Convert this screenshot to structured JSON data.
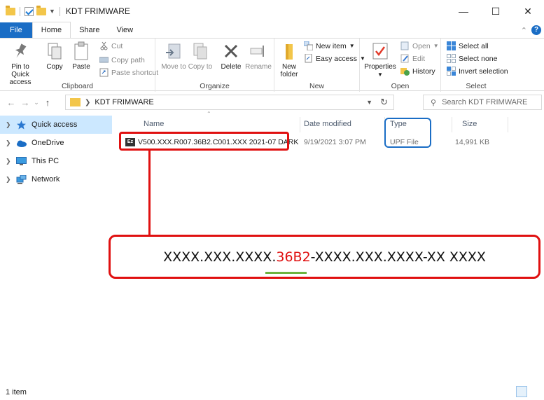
{
  "window": {
    "title": "KDT FRIMWARE",
    "minimize": "—",
    "maximize": "☐",
    "close": "✕"
  },
  "ribbon_tabs": [
    "File",
    "Home",
    "Share",
    "View"
  ],
  "ribbon": {
    "clipboard": {
      "label": "Clipboard",
      "pin": "Pin to Quick access",
      "copy": "Copy",
      "paste": "Paste",
      "cut": "Cut",
      "copy_path": "Copy path",
      "paste_shortcut": "Paste shortcut"
    },
    "organize": {
      "label": "Organize",
      "move_to": "Move to",
      "copy_to": "Copy to",
      "delete": "Delete",
      "rename": "Rename"
    },
    "new": {
      "label": "New",
      "new_folder": "New folder",
      "new_item": "New item",
      "easy_access": "Easy access"
    },
    "open": {
      "label": "Open",
      "properties": "Properties",
      "open": "Open",
      "edit": "Edit",
      "history": "History"
    },
    "select": {
      "label": "Select",
      "select_all": "Select all",
      "select_none": "Select none",
      "invert_selection": "Invert selection"
    }
  },
  "address": {
    "path": "KDT FRIMWARE",
    "search_placeholder": "Search KDT FRIMWARE"
  },
  "nav_pane": [
    {
      "label": "Quick access",
      "icon": "star-icon"
    },
    {
      "label": "OneDrive",
      "icon": "cloud-icon"
    },
    {
      "label": "This PC",
      "icon": "monitor-icon"
    },
    {
      "label": "Network",
      "icon": "network-icon"
    }
  ],
  "columns": [
    "Name",
    "Date modified",
    "Type",
    "Size"
  ],
  "files": [
    {
      "name": "V500.XXX.R007.36B2.C001.XXX 2021-07 DARK",
      "date_modified": "9/19/2021 3:07 PM",
      "type": "UPF File",
      "size": "14,991 KB"
    }
  ],
  "callout": {
    "prefix": "XXXX.XXX.XXXX.",
    "highlight": "36B2",
    "suffix": "-XXXX.XXX.XXXX-XX XXXX"
  },
  "status": {
    "item_count": "1 item"
  },
  "colors": {
    "file_tab": "#1a6dc5",
    "annotation_red": "#e01010",
    "annotation_blue": "#1a6dc5",
    "underline_green": "#6db33f",
    "selected_nav": "#cce8ff"
  }
}
